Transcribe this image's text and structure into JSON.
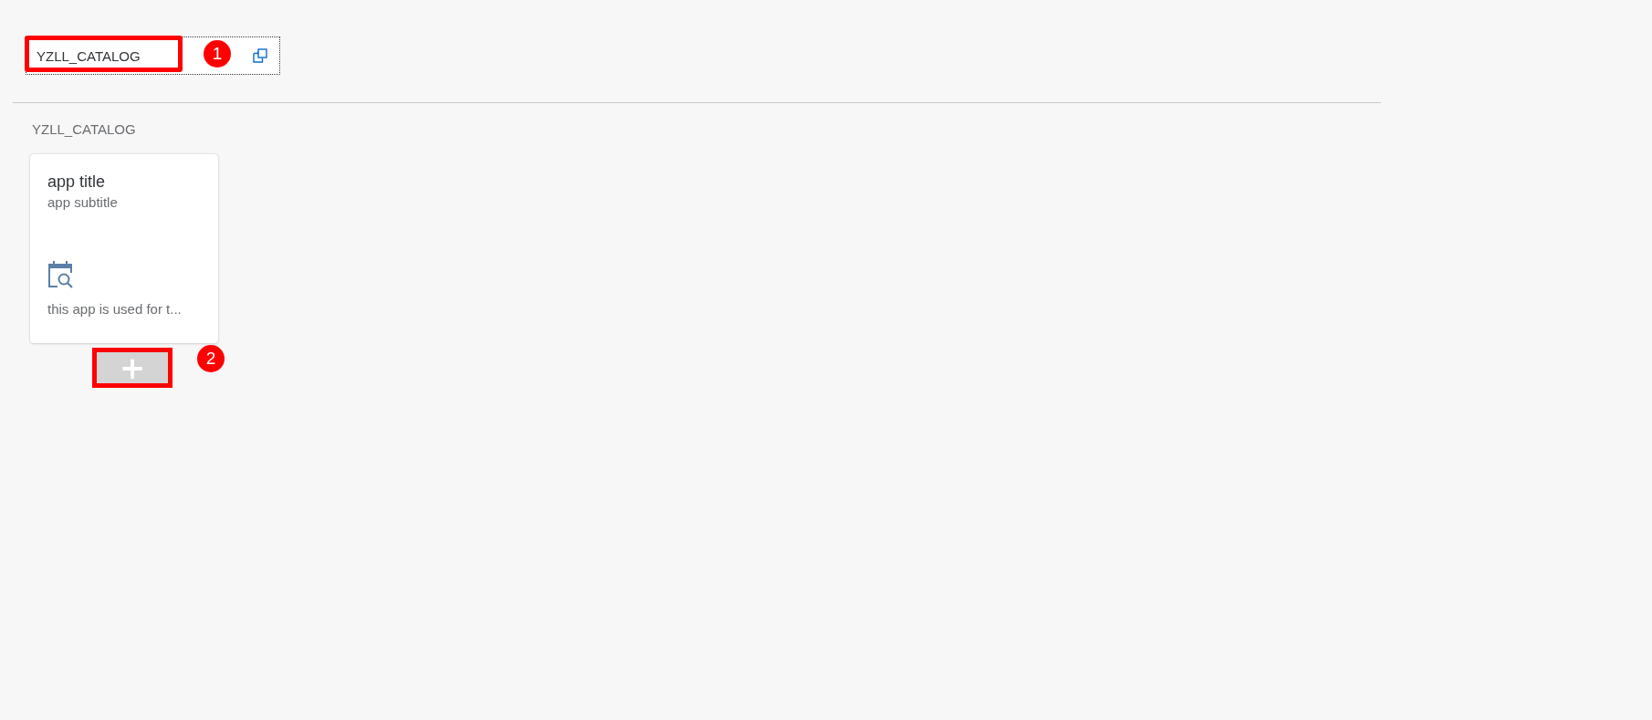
{
  "catalog_field": {
    "value": "YZLL_CATALOG"
  },
  "section_title": "YZLL_CATALOG",
  "tiles": [
    {
      "title": "app title",
      "subtitle": "app subtitle",
      "footer": "this app is used for t..."
    }
  ],
  "add_button": {
    "label": "+"
  },
  "annotations": [
    {
      "label": "1"
    },
    {
      "label": "2"
    }
  ]
}
